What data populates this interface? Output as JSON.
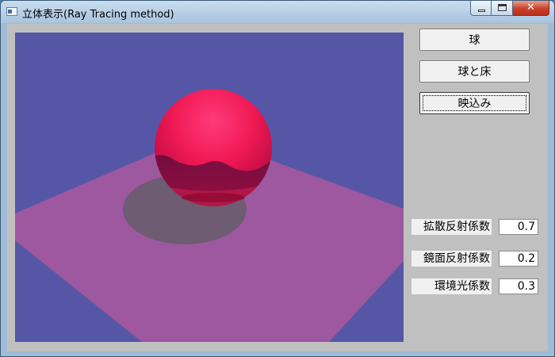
{
  "window": {
    "title": "立体表示(Ray Tracing method)",
    "caption_close": "✕"
  },
  "buttons": {
    "sphere_label": "球",
    "sphere_floor_label": "球と床",
    "reflection_label": "映込み"
  },
  "params": {
    "diffuse": {
      "label": "拡散反射係数",
      "value": "0.7"
    },
    "specular": {
      "label": "鏡面反射係数",
      "value": "0.2"
    },
    "ambient": {
      "label": "環境光係数",
      "value": "0.3"
    }
  },
  "colors": {
    "background": "#5656a6",
    "floor": "#9d58a0",
    "shadow": "#6e5c72",
    "sphere": "#ff1f60",
    "sphere_dark": "#7a0a3a",
    "panel": "#c0c0c0"
  }
}
